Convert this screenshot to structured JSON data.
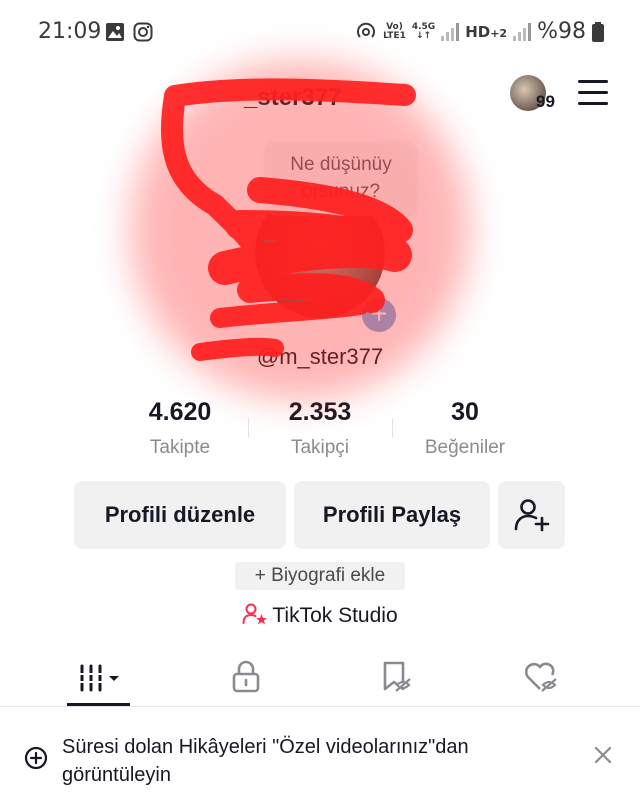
{
  "status_bar": {
    "time": "21:09",
    "battery": "%98",
    "icons": [
      "image-icon",
      "instagram-icon",
      "hotspot-icon",
      "volte-icon",
      "signal-icon",
      "hd-plus-icon",
      "battery-icon"
    ],
    "volte_top": "Vo)",
    "volte_bottom": "LTE1",
    "net_top": "4.5G",
    "net_bottom": "↓↑",
    "hd": "HD",
    "sim2": "+2"
  },
  "header": {
    "username_partial": "_ster377",
    "story_count": "99",
    "menu_icon": "hamburger-menu-icon"
  },
  "thought_bubble": {
    "line1": "Ne düşünüy",
    "line2": "orsunuz?"
  },
  "profile": {
    "handle": "@m_ster377",
    "add_story_icon": "plus-icon"
  },
  "stats": [
    {
      "value": "4.620",
      "label": "Takipte"
    },
    {
      "value": "2.353",
      "label": "Takipçi"
    },
    {
      "value": "30",
      "label": "Beğeniler"
    }
  ],
  "actions": {
    "edit_profile": "Profili düzenle",
    "share_profile": "Profili Paylaş",
    "add_friend_icon": "add-person-icon"
  },
  "bio": {
    "add_label": "+ Biyografi ekle"
  },
  "studio": {
    "label": "TikTok Studio",
    "icon": "creator-person-star-icon"
  },
  "tabs": [
    {
      "name": "videos-grid-icon",
      "active": true
    },
    {
      "name": "lock-icon",
      "active": false
    },
    {
      "name": "bookmark-hidden-icon",
      "active": false
    },
    {
      "name": "liked-hidden-icon",
      "active": false
    }
  ],
  "notice": {
    "text": "Süresi dolan Hikâyeleri \"Özel videolarınız\"dan görüntüleyin",
    "icon": "story-plus-icon",
    "close_icon": "close-icon"
  },
  "colors": {
    "accent_pink": "#fe2c55",
    "redaction_red": "#ff2a2a",
    "button_bg": "#f1f1f2"
  }
}
